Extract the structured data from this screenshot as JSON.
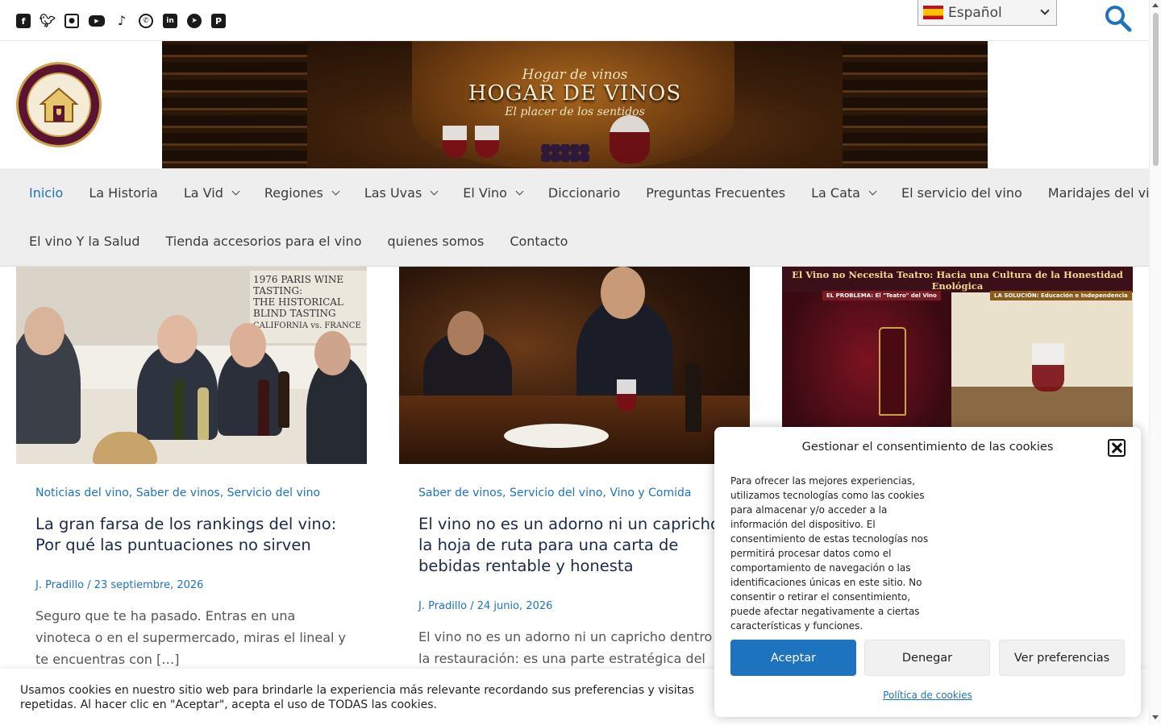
{
  "top_bar": {
    "social_icons": [
      "facebook-icon",
      "twitter-icon",
      "instagram-icon",
      "youtube-icon",
      "tiktok-icon",
      "whatsapp-icon",
      "linkedin-icon",
      "telegram-icon",
      "pinterest-icon"
    ],
    "language": {
      "selected": "Español",
      "flag": "spain-flag-icon"
    },
    "search_icon": "search-icon"
  },
  "header": {
    "logo_alt": "Hogar de Vinos logo",
    "banner": {
      "subtitle": "Hogar de vinos",
      "title": "HOGAR DE VINOS",
      "tagline": "El placer de los sentidos"
    }
  },
  "nav": {
    "row1": [
      {
        "label": "Inicio",
        "active": true,
        "has_submenu": false
      },
      {
        "label": "La Historia",
        "has_submenu": false
      },
      {
        "label": "La Vid",
        "has_submenu": true
      },
      {
        "label": "Regiones",
        "has_submenu": true
      },
      {
        "label": "Las Uvas",
        "has_submenu": true
      },
      {
        "label": "El Vino",
        "has_submenu": true
      },
      {
        "label": "Diccionario",
        "has_submenu": false
      },
      {
        "label": "Preguntas Frecuentes",
        "has_submenu": false
      },
      {
        "label": "La Cata",
        "has_submenu": true
      },
      {
        "label": "El servicio del vino",
        "has_submenu": false
      },
      {
        "label": "Maridajes del vino",
        "has_submenu": false
      }
    ],
    "row2": [
      {
        "label": "El vino Y la Salud"
      },
      {
        "label": "Tienda accesorios para el vino"
      },
      {
        "label": "quienes somos"
      },
      {
        "label": "Contacto"
      }
    ]
  },
  "posts": [
    {
      "thumb_poster": [
        "1976 PARIS WINE TASTING:",
        "THE HISTORICAL BLIND TASTING",
        "CALIFORNIA vs. FRANCE"
      ],
      "categories": [
        "Noticias del vino",
        "Saber de vinos",
        "Servicio del vino"
      ],
      "title": "La gran farsa de los rankings del vino: Por qué las puntuaciones no sirven",
      "author": "J. Pradillo",
      "date": "23 septiembre, 2026",
      "excerpt": "Seguro que te ha pasado. Entras en una vinoteca o en el supermercado, miras el lineal y te encuentras con […]"
    },
    {
      "categories": [
        "Saber de vinos",
        "Servicio del vino",
        "Vino y Comida"
      ],
      "title": "El vino no es un adorno ni un capricho: la hoja de ruta para una carta de bebidas rentable y honesta",
      "author": "J. Pradillo",
      "date": "24 junio, 2026",
      "excerpt": "El vino no es un adorno ni un capricho dentro de la restauración: es una parte estratégica del negocio,"
    },
    {
      "thumb_title": "El Vino no Necesita Teatro: Hacia una Cultura de la Honestidad Enológica",
      "thumb_labels": [
        "EL PROBLEMA: El \"Teatro\" del Vino",
        "LA SOLUCIÓN: Educación e Independencia"
      ]
    }
  ],
  "cookie_bar": {
    "text": "Usamos cookies en nuestro sitio web para brindarle la experiencia más relevante recordando sus preferencias y visitas repetidas. Al hacer clic en \"Aceptar\", acepta el uso de TODAS las cookies."
  },
  "cookie_modal": {
    "title": "Gestionar el consentimiento de las cookies",
    "text": "Para ofrecer las mejores experiencias, utilizamos tecnologías como las cookies para almacenar y/o acceder a la información del dispositivo. El consentimiento de estas tecnologías nos permitirá procesar datos como el comportamiento de navegación o las identificaciones únicas en este sitio. No consentir o retirar el consentimiento, puede afectar negativamente a ciertas características y funciones.",
    "accept": "Aceptar",
    "deny": "Denegar",
    "preferences": "Ver preferencias",
    "policy_link": "Política de cookies"
  },
  "colors": {
    "accent": "#1e73be",
    "nav_bg": "#eeeeee",
    "title": "#1b2a4a"
  }
}
